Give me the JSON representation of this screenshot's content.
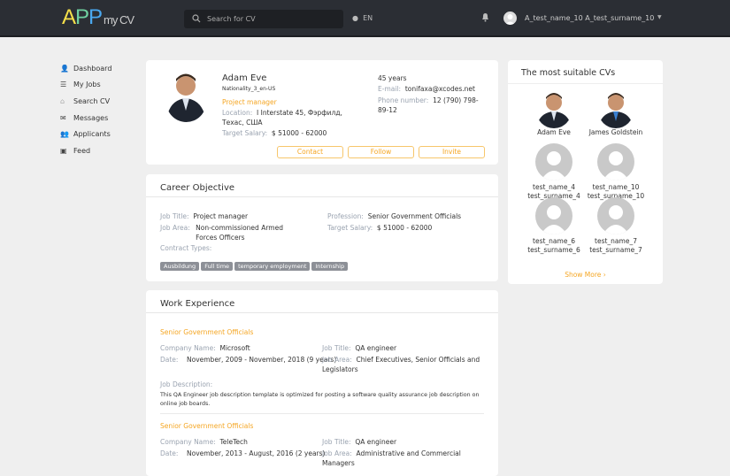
{
  "header": {
    "logo": "APP my CV",
    "search_placeholder": "Search for CV",
    "language": "EN",
    "user_name": "A_test_name_10 A_test_surname_10"
  },
  "sidebar": {
    "items": [
      {
        "label": "Dashboard",
        "icon": "user-icon"
      },
      {
        "label": "My Jobs",
        "icon": "list-icon"
      },
      {
        "label": "Search CV",
        "icon": "search-cv-icon"
      },
      {
        "label": "Messages",
        "icon": "envelope-icon"
      },
      {
        "label": "Applicants",
        "icon": "people-icon"
      },
      {
        "label": "Feed",
        "icon": "feed-icon"
      }
    ]
  },
  "profile": {
    "name": "Adam Eve",
    "nationality": "Nationality_3_en-US",
    "position": "Project manager",
    "location_label": "Location:",
    "location": "I Interstate 45, Фэрфилд, Техас, США",
    "salary_label": "Target Salary:",
    "salary": "$ 51000 - 62000",
    "age": "45 years",
    "email_label": "E-mail:",
    "email": "tonifaxa@xcodes.net",
    "phone_label": "Phone number:",
    "phone": "12 (790) 798-89-12",
    "buttons": {
      "contact": "Contact",
      "follow": "Follow",
      "invite": "Invite"
    }
  },
  "career": {
    "title": "Career Objective",
    "job_title_label": "Job Title:",
    "job_title": "Project manager",
    "job_area_label": "Job Area:",
    "job_area": "Non-commissioned Armed Forces Officers",
    "profession_label": "Profession:",
    "profession": "Senior Government Officials",
    "salary_label": "Target Salary:",
    "salary": "$ 51000 - 62000",
    "contract_label": "Contract Types:",
    "contract_types": [
      "Ausbildung",
      "Full time",
      "temporary employment",
      "Internship"
    ]
  },
  "work": {
    "title": "Work Experience",
    "entries": [
      {
        "heading": "Senior Government Officials",
        "company_label": "Company Name:",
        "company": "Microsoft",
        "date_label": "Date:",
        "date": "November, 2009 - November, 2018 (9 years)",
        "job_title_label": "Job Title:",
        "job_title": "QA engineer",
        "job_area_label": "Job Area:",
        "job_area": "Chief Executives, Senior Officials and Legislators",
        "desc_label": "Job Description:",
        "desc": "This QA Engineer job description template is optimized for posting a software quality assurance job description on online job boards."
      },
      {
        "heading": "Senior Government Officials",
        "company_label": "Company Name:",
        "company": "TeleTech",
        "date_label": "Date:",
        "date": "November, 2013 - August, 2016 (2 years)",
        "job_title_label": "Job Title:",
        "job_title": "QA engineer",
        "job_area_label": "Job Area:",
        "job_area": "Administrative and Commercial Managers"
      }
    ]
  },
  "suitable": {
    "title": "The most suitable CVs",
    "people": [
      {
        "line1": "Adam Eve",
        "line2": ""
      },
      {
        "line1": "James Goldstein",
        "line2": ""
      },
      {
        "line1": "test_name_4",
        "line2": "test_surname_4"
      },
      {
        "line1": "test_name_10",
        "line2": "test_surname_10"
      },
      {
        "line1": "test_name_6",
        "line2": "test_surname_6"
      },
      {
        "line1": "test_name_7",
        "line2": "test_surname_7"
      }
    ],
    "show_more": "Show More"
  }
}
